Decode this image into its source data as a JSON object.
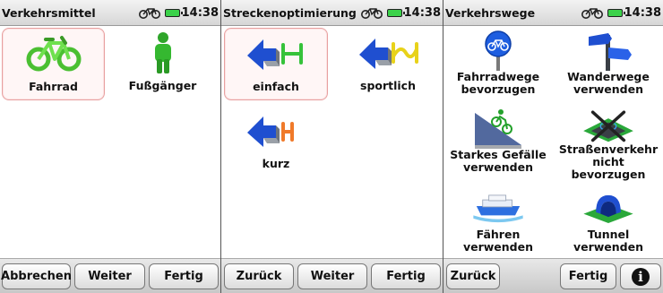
{
  "status": {
    "clock": "14:38"
  },
  "screens": [
    {
      "title": "Verkehrsmittel",
      "tiles": [
        {
          "label": "Fahrrad",
          "icon": "bicycle-icon",
          "selected": true
        },
        {
          "label": "Fußgänger",
          "icon": "pedestrian-icon",
          "selected": false
        }
      ],
      "buttons": [
        "Abbrechen",
        "Weiter",
        "Fertig"
      ]
    },
    {
      "title": "Streckenoptimierung",
      "tiles": [
        {
          "label": "einfach",
          "icon": "route-simple-icon",
          "selected": true
        },
        {
          "label": "sportlich",
          "icon": "route-sporty-icon",
          "selected": false
        },
        {
          "label": "kurz",
          "icon": "route-short-icon",
          "selected": false
        }
      ],
      "buttons": [
        "Zurück",
        "Weiter",
        "Fertig"
      ]
    },
    {
      "title": "Verkehrswege",
      "tiles": [
        {
          "label_line1": "Fahrradwege",
          "label_line2": "bevorzugen",
          "icon": "bike-path-sign-icon"
        },
        {
          "label_line1": "Wanderwege",
          "label_line2": "verwenden",
          "icon": "hiking-signpost-icon"
        },
        {
          "label_line1": "Starkes Gefälle",
          "label_line2": "verwenden",
          "icon": "steep-slope-icon"
        },
        {
          "label_line1": "Straßenverkehr",
          "label_line2": "nicht bevorzugen",
          "icon": "road-traffic-crossed-icon"
        },
        {
          "label": "Fähren verwenden",
          "icon": "ferry-icon"
        },
        {
          "label": "Tunnel verwenden",
          "icon": "tunnel-icon"
        }
      ],
      "buttons": [
        "Zurück",
        "Fertig"
      ],
      "info_icon": "info-icon"
    }
  ],
  "colors": {
    "accent_green": "#3bd24a",
    "route_blue": "#1f4fd0",
    "selected_border": "#e8a0a0"
  }
}
